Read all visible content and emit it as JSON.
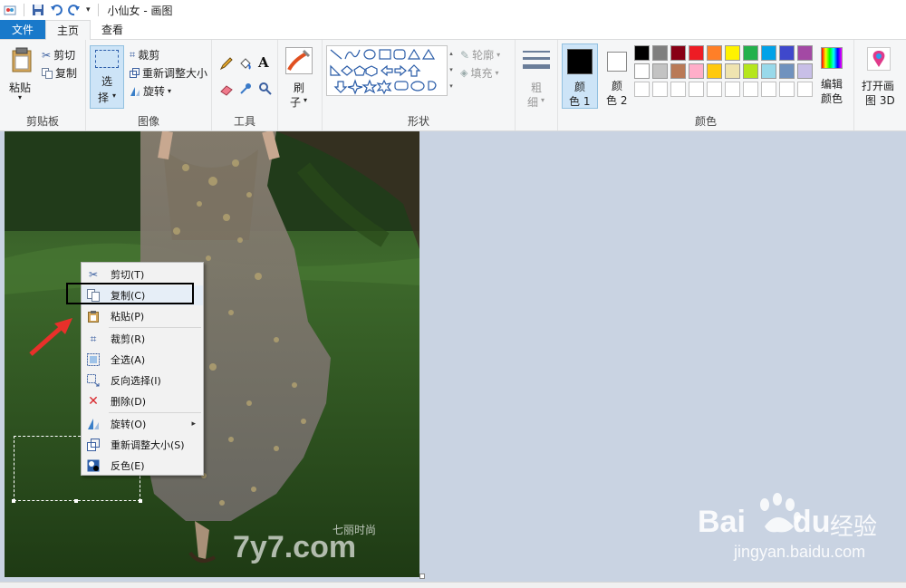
{
  "window": {
    "title": "小仙女 - 画图"
  },
  "tabs": {
    "file": "文件",
    "home": "主页",
    "view": "查看"
  },
  "ribbon": {
    "clipboard": {
      "paste": "粘贴",
      "cut": "剪切",
      "copy": "复制",
      "label": "剪贴板"
    },
    "image": {
      "select_top": "选",
      "select_bottom": "择",
      "crop": "裁剪",
      "resize": "重新调整大小",
      "rotate": "旋转",
      "label": "图像"
    },
    "tools": {
      "label": "工具",
      "text_tool": "A"
    },
    "brushes": {
      "top": "刷",
      "bottom": "子"
    },
    "shapes": {
      "outline": "轮廓",
      "fill": "填充",
      "label": "形状"
    },
    "size": {
      "top": "粗",
      "bottom": "细"
    },
    "colors": {
      "color1_top": "颜",
      "color1_bottom": "色 1",
      "color2_top": "颜",
      "color2_bottom": "色 2",
      "edit_top": "编辑",
      "edit_bottom": "颜色",
      "label": "颜色",
      "palette_row1": [
        "#000000",
        "#7f7f7f",
        "#880015",
        "#ed1c24",
        "#ff7f27",
        "#fff200",
        "#22b14c",
        "#00a2e8",
        "#3f48cc",
        "#a349a4"
      ],
      "palette_row2": [
        "#ffffff",
        "#c3c3c3",
        "#b97a57",
        "#ffaec9",
        "#ffc90e",
        "#efe4b0",
        "#b5e61d",
        "#99d9ea",
        "#7092be",
        "#c8bfe7"
      ],
      "color1": "#000000",
      "color2": "#ffffff"
    },
    "paint3d": {
      "top": "打开画",
      "bottom": "图 3D"
    }
  },
  "context_menu": {
    "items": [
      {
        "label": "剪切(T)",
        "icon": "scissors-icon"
      },
      {
        "label": "复制(C)",
        "icon": "copy-icon"
      },
      {
        "label": "粘贴(P)",
        "icon": "clipboard-icon"
      },
      {
        "label": "裁剪(R)",
        "icon": "crop-icon"
      },
      {
        "label": "全选(A)",
        "icon": "select-all-icon"
      },
      {
        "label": "反向选择(I)",
        "icon": "invert-selection-icon"
      },
      {
        "label": "删除(D)",
        "icon": "delete-icon"
      },
      {
        "label": "旋转(O)",
        "icon": "rotate-icon"
      },
      {
        "label": "重新调整大小(S)",
        "icon": "resize-icon"
      },
      {
        "label": "反色(E)",
        "icon": "invert-color-icon"
      }
    ]
  },
  "watermarks": {
    "site_cn": "七丽时尚",
    "site": "7y7.com",
    "baidu": "Bai",
    "baidu_du": "du",
    "baidu_cn": "经验",
    "baidu_url": "jingyan.baidu.com"
  }
}
